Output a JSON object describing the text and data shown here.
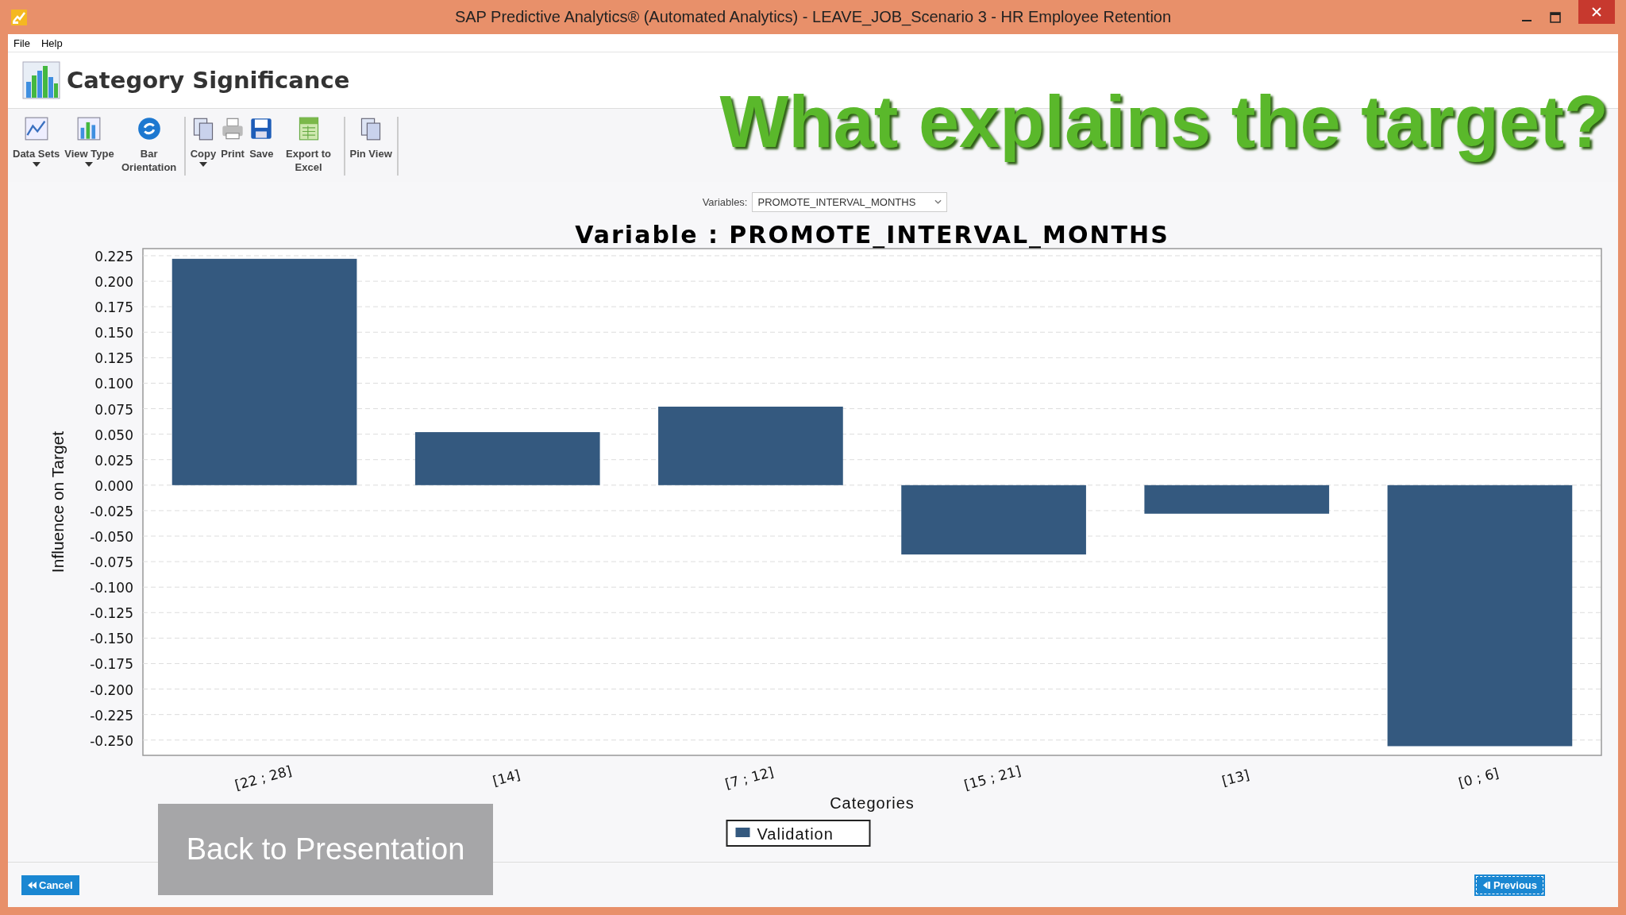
{
  "window": {
    "title": "SAP Predictive Analytics® (Automated Analytics) - LEAVE_JOB_Scenario 3 - HR Employee Retention"
  },
  "menu": [
    "File",
    "Help"
  ],
  "header": {
    "title": "Category Significance"
  },
  "overlay_caption": "What explains the target?",
  "toolbar": [
    [
      {
        "label": "Data Sets",
        "dropdown": true
      },
      {
        "label": "View Type",
        "dropdown": true
      },
      {
        "label": "Bar Orientation",
        "dropdown": false
      }
    ],
    [
      {
        "label": "Copy",
        "dropdown": true
      },
      {
        "label": "Print",
        "dropdown": false
      },
      {
        "label": "Save",
        "dropdown": false
      },
      {
        "label": "Export to Excel",
        "dropdown": false
      }
    ],
    [
      {
        "label": "Pin View",
        "dropdown": false
      }
    ]
  ],
  "variables": {
    "label": "Variables:",
    "value": "PROMOTE_INTERVAL_MONTHS"
  },
  "chart_data": {
    "type": "bar",
    "title": "Variable : PROMOTE_INTERVAL_MONTHS",
    "xlabel": "Categories",
    "ylabel": "Influence on Target",
    "categories": [
      "[22 ; 28]",
      "[14]",
      "[7 ; 12]",
      "[15 ; 21]",
      "[13]",
      "[0 ; 6]"
    ],
    "series": [
      {
        "name": "Validation",
        "color": "#34597f",
        "values": [
          0.222,
          0.052,
          0.077,
          -0.068,
          -0.028,
          -0.256
        ]
      }
    ],
    "ylim": [
      -0.265,
      0.232
    ],
    "grid": true,
    "yticks": [
      {
        "value": 0.225,
        "label": "0.225"
      },
      {
        "value": 0.2,
        "label": "0.200"
      },
      {
        "value": 0.175,
        "label": "0.175"
      },
      {
        "value": 0.15,
        "label": "0.150"
      },
      {
        "value": 0.125,
        "label": "0.125"
      },
      {
        "value": 0.1,
        "label": "0.100"
      },
      {
        "value": 0.075,
        "label": "0.075"
      },
      {
        "value": 0.05,
        "label": "0.050"
      },
      {
        "value": 0.025,
        "label": "0.025"
      },
      {
        "value": 0,
        "label": "0.000"
      },
      {
        "value": -0.025,
        "label": "-0.025"
      },
      {
        "value": -0.05,
        "label": "-0.050"
      },
      {
        "value": -0.075,
        "label": "-0.075"
      },
      {
        "value": -0.1,
        "label": "-0.100"
      },
      {
        "value": -0.125,
        "label": "-0.125"
      },
      {
        "value": -0.15,
        "label": "-0.150"
      },
      {
        "value": -0.175,
        "label": "-0.175"
      },
      {
        "value": -0.2,
        "label": "-0.200"
      },
      {
        "value": -0.225,
        "label": "-0.225"
      },
      {
        "value": -0.25,
        "label": "-0.250"
      }
    ]
  },
  "back_button": "Back to Presentation",
  "footer": {
    "cancel": "Cancel",
    "previous": "Previous"
  }
}
